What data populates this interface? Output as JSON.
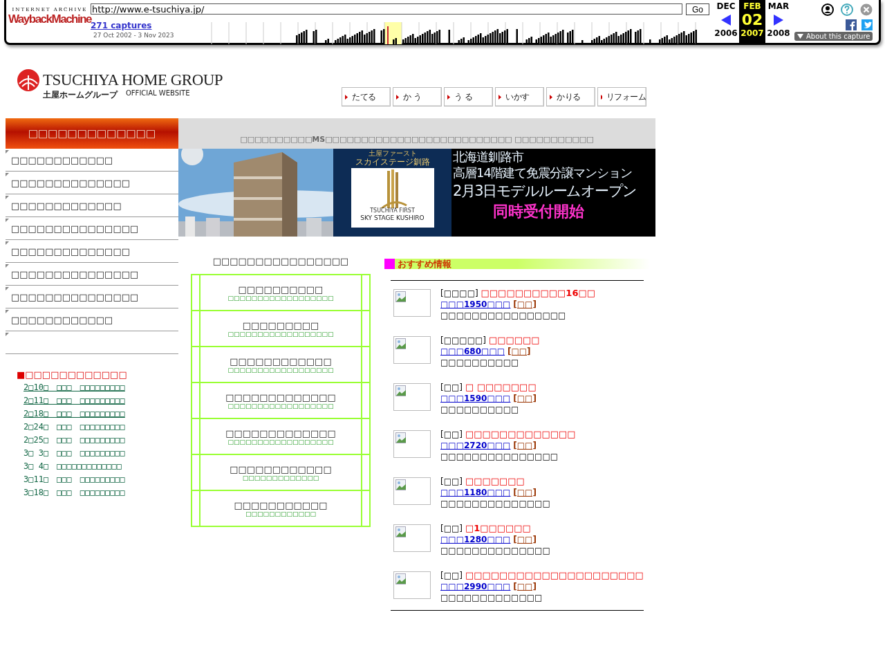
{
  "wayback": {
    "logo_top": "INTERNET ARCHIVE",
    "logo": "WaybackMachine",
    "url": "http://www.e-tsuchiya.jp/",
    "go": "Go",
    "captures": "271 captures",
    "range": "27 Oct 2002 - 3 Nov 2023",
    "columns": [
      {
        "month": "DEC",
        "year": "2006",
        "selected": false
      },
      {
        "month": "FEB",
        "day": "02",
        "year": "2007",
        "selected": true
      },
      {
        "month": "MAR",
        "year": "2008",
        "selected": false
      }
    ],
    "about": "About this capture"
  },
  "logo": {
    "name": "TSUCHIYA HOME GROUP",
    "sub": "土屋ホームグループ",
    "tag": "OFFICIAL WEBSITE"
  },
  "nav": [
    "たてる",
    "か う",
    "う る",
    "いかす",
    "かりる",
    "リフォーム"
  ],
  "sidebar": {
    "title": "□□□□□□□□□□□□□",
    "items": [
      "□□□□□□□□□□□□",
      "□□□□□□□□□□□□□□",
      "□□□□□□□□□□□□□",
      "□□□□□□□□□□□□□□□",
      "□□□□□□□□□□□□□□",
      "□□□□□□□□□□□□□□□",
      "□□□□□□□□□□□□□□□",
      "□□□□□□□□□□□□"
    ]
  },
  "events": {
    "title": "■□□□□□□□□□□□□",
    "items": [
      {
        "text": "2□10□　□□□　□□□□□□□□□",
        "underlined": true
      },
      {
        "text": "2□11□　□□□　□□□□□□□□□",
        "underlined": true
      },
      {
        "text": "2□18□　□□□　□□□□□□□□□",
        "underlined": true
      },
      {
        "text": "2□24□　□□□　□□□□□□□□□",
        "underlined": false
      },
      {
        "text": "2□25□　□□□　□□□□□□□□□",
        "underlined": false
      },
      {
        "text": "3□ 3□　□□□　□□□□□□□□□",
        "underlined": false
      },
      {
        "text": "3□ 4□　□□□□□□□□□□□□□",
        "underlined": false
      },
      {
        "text": "3□11□　□□□　□□□□□□□□□",
        "underlined": false
      },
      {
        "text": "3□18□　□□□　□□□□□□□□□",
        "underlined": false
      }
    ]
  },
  "banner": {
    "caption": "□□□□□□□□□□MS□□□□□□□□□□□□□□□□□□□□□□□□□□ □□□□□□□□□□□",
    "brand_top": "土屋ファースト",
    "brand": "スカイステージ釧路",
    "brand_en_top": "TSUCHIYA FIRST",
    "brand_en": "SKY STAGE KUSHIRO",
    "lines": [
      {
        "text": "北海道釧路市",
        "kind": "plain"
      },
      {
        "text": "高層14階建て免震分譲マンション",
        "kind": "plain"
      },
      {
        "text": "2月3日モデルルームオープン",
        "kind": "large"
      },
      {
        "text": "同時受付開始",
        "kind": "accent"
      }
    ]
  },
  "menu": {
    "title": "□□□□□□□□□□□□□□□□",
    "items": [
      {
        "title": "□□□□□□□□□□",
        "subtitle": "□□□□□□□□□□□□□□□□□□"
      },
      {
        "title": "□□□□□□□□□",
        "subtitle": "□□□□□□□□□□□□□□□□□□"
      },
      {
        "title": "□□□□□□□□□□□□",
        "subtitle": "□□□□□□□□□□□□□□□□□□"
      },
      {
        "title": "□□□□□□□□□□□□□",
        "subtitle": "□□□□□□□□□□□□□□□□□□"
      },
      {
        "title": "□□□□□□□□□□□□□",
        "subtitle": "□□□□□□□□□□□□□□□□□□"
      },
      {
        "title": "□□□□□□□□□□□□",
        "subtitle": "□□□□□□□□□□□□□"
      },
      {
        "title": "□□□□□□□□□□□",
        "subtitle": "□□□□□□□□□□□□"
      }
    ]
  },
  "recommend": {
    "title": "おすすめ情報",
    "items": [
      {
        "tag": "[□□□□]",
        "name": "□□□□□□□□□□16□□",
        "price": "□□□1950□□□",
        "link": "[□□]",
        "desc": "□□□□□□□□□□□□□□□□"
      },
      {
        "tag": "[□□□□□]",
        "name": "□□□□□□",
        "price": "□□□680□□□",
        "link": "[□□]",
        "desc": "□□□□□□□□□□"
      },
      {
        "tag": "[□□]",
        "name": "□ □□□□□□□",
        "price": "□□□1590□□□",
        "link": "[□□]",
        "desc": "□□□□□□□□□□"
      },
      {
        "tag": "[□□]",
        "name": "□□□□□□□□□□□□□",
        "price": "□□□2720□□□",
        "link": "[□□]",
        "desc": "□□□□□□□□□□□□□□□"
      },
      {
        "tag": "[□□]",
        "name": "□□□□□□□",
        "price": "□□□1180□□□",
        "link": "[□□]",
        "desc": "□□□□□□□□□□□□□□"
      },
      {
        "tag": "[□□]",
        "name": "□1□□□□□□",
        "price": "□□□1280□□□",
        "link": "[□□]",
        "desc": "□□□□□□□□□□□□□□"
      },
      {
        "tag": "[□□]",
        "name": "□□□□□□□□□□□□□□□□□□□□□",
        "price": "□□□2990□□□",
        "link": "[□□]",
        "desc": "□□□□□□□□□□□□□"
      }
    ]
  }
}
